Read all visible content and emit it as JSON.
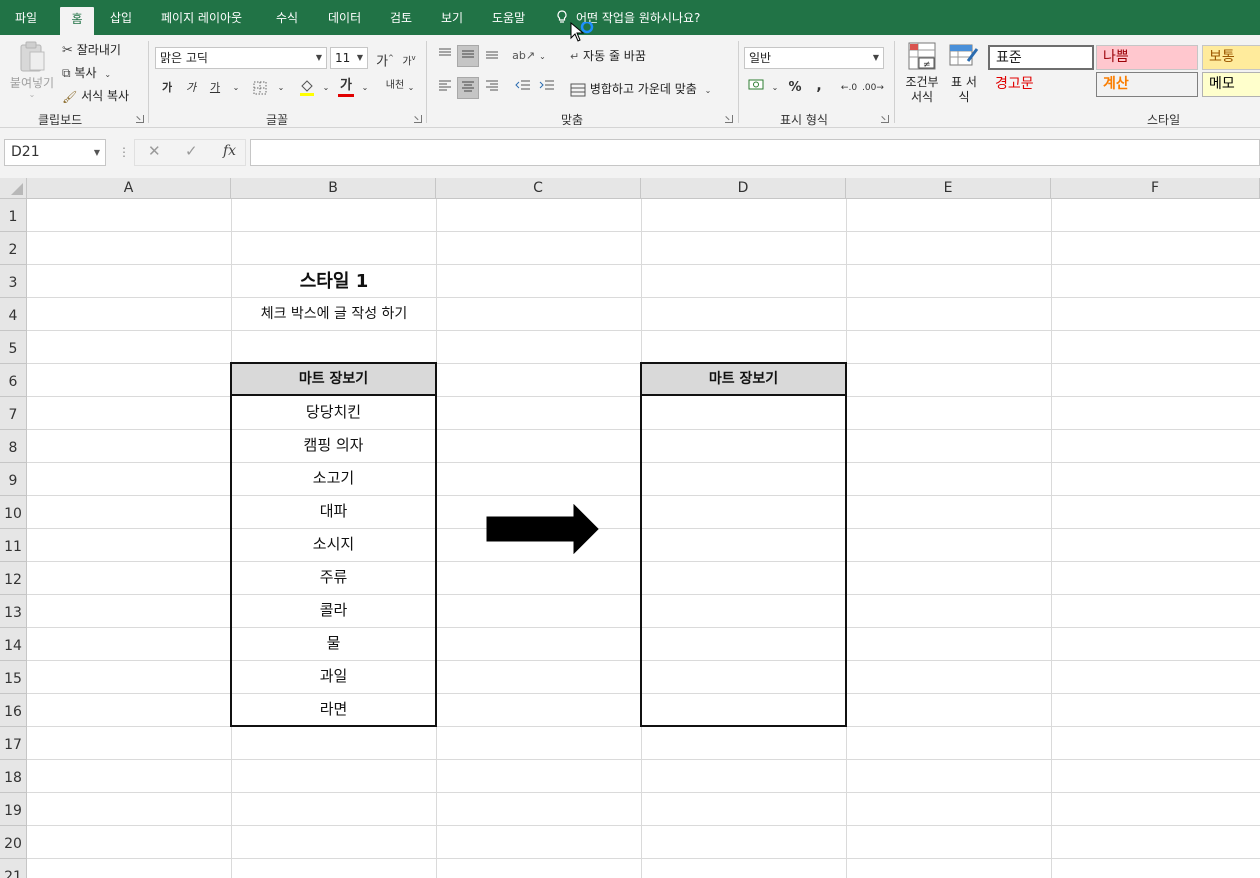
{
  "ribbon_tabs": [
    {
      "label": "파일",
      "active": false
    },
    {
      "label": "홈",
      "active": true
    },
    {
      "label": "삽입",
      "active": false
    },
    {
      "label": "페이지 레이아웃",
      "active": false
    },
    {
      "label": "수식",
      "active": false
    },
    {
      "label": "데이터",
      "active": false
    },
    {
      "label": "검토",
      "active": false
    },
    {
      "label": "보기",
      "active": false
    },
    {
      "label": "도움말",
      "active": false
    }
  ],
  "tell_me": "어떤 작업을 원하시나요?",
  "clipboard": {
    "paste_label": "붙여넣기",
    "cut_label": "잘라내기",
    "copy_label": "복사",
    "format_painter_label": "서식 복사",
    "group_label": "클립보드"
  },
  "font": {
    "font_name": "맑은 고딕",
    "font_size": "11",
    "bold": "가",
    "italic": "가",
    "underline": "가",
    "font_color_glyph": "가",
    "phonetic": "내천",
    "grow": "가",
    "shrink": "가",
    "group_label": "글꼴"
  },
  "alignment": {
    "wrap_text_label": "자동 줄 바꿈",
    "merge_center_label": "병합하고 가운데 맞춤",
    "group_label": "맞춤"
  },
  "number": {
    "format_value": "일반",
    "percent": "%",
    "comma": ",",
    "group_label": "표시 형식"
  },
  "styles": {
    "conditional_format_label": "조건부 서식",
    "table_format_label": "표 서식",
    "cells": [
      {
        "label": "표준",
        "bg": "#ffffff",
        "color": "#000000"
      },
      {
        "label": "나쁨",
        "bg": "#ffc7ce",
        "color": "#9c0006"
      },
      {
        "label": "보통",
        "bg": "#ffeb9c",
        "color": "#9c5700"
      },
      {
        "label": "경고문",
        "bg": "#f3f3f3",
        "color": "#ff0000"
      },
      {
        "label": "계산",
        "bg": "#f2f2f2",
        "color": "#fa7d00"
      },
      {
        "label": "메모",
        "bg": "#ffffcc",
        "color": "#000000"
      }
    ],
    "group_label": "스타일"
  },
  "formula_bar": {
    "name_box": "D21",
    "fx_label": "fx",
    "formula": ""
  },
  "columns": [
    "A",
    "B",
    "C",
    "D",
    "E",
    "F"
  ],
  "rows": [
    "1",
    "2",
    "3",
    "4",
    "5",
    "6",
    "7",
    "8",
    "9",
    "10",
    "11",
    "12",
    "13",
    "14",
    "15",
    "16",
    "17",
    "18",
    "19",
    "20",
    "21"
  ],
  "sheet": {
    "title": "스타일 1",
    "subtitle": "체크 박스에 글 작성 하기",
    "left_table": {
      "header": "마트 장보기",
      "items": [
        "당당치킨",
        "캠핑 의자",
        "소고기",
        "대파",
        "소시지",
        "주류",
        "콜라",
        "물",
        "과일",
        "라면"
      ]
    },
    "right_table": {
      "header": "마트 장보기",
      "items": [
        "",
        "",
        "",
        "",
        "",
        "",
        "",
        "",
        "",
        ""
      ]
    }
  },
  "colors": {
    "ribbon_green": "#217346",
    "header_fill": "#d9d9d9",
    "border": "#111111"
  }
}
